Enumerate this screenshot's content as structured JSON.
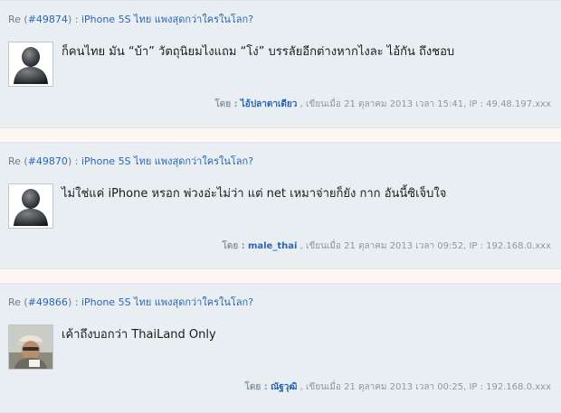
{
  "comments": [
    {
      "prefix": "Re (",
      "id_link": "#49874",
      "suffix": ") : ",
      "topic": "iPhone 5S ไทย แพงสุดกว่าใครในโลก?",
      "text": "ก็คนไทย มัน “บ้า” วัตถุนิยมไงแถม “โง่” บรรลัยอีกต่างหากไงละ ไอ้กัน ถึงชอบ",
      "by_label": "โดย :",
      "author": "ไอ้ปลาตาเดียว",
      "posted": ", เขียนเมื่อ 21 ตุลาคม 2013 เวลา 15:41, IP : 49.48.197.xxx",
      "avatar": "default-user-avatar"
    },
    {
      "prefix": "Re (",
      "id_link": "#49870",
      "suffix": ") : ",
      "topic": "iPhone 5S ไทย แพงสุดกว่าใครในโลก?",
      "text": "ไม่ใช่แค่ iPhone หรอก พ่วงอ่ะไม่ว่า แต่ net เหมาจ่ายก็ยัง กาก อันนี้ซิเจ็บใจ",
      "by_label": "โดย :",
      "author": "male_thai",
      "posted": ", เขียนเมื่อ 21 ตุลาคม 2013 เวลา 09:52, IP : 192.168.0.xxx",
      "avatar": "default-user-avatar"
    },
    {
      "prefix": "Re (",
      "id_link": "#49866",
      "suffix": ") : ",
      "topic": "iPhone 5S ไทย แพงสุดกว่าใครในโลก?",
      "text": "เค้าถึงบอกว่า ThaiLand Only",
      "by_label": "โดย :",
      "author": "ณัฐวุฒิ",
      "posted": ", เขียนเมื่อ 21 ตุลาคม 2013 เวลา 00:25, IP : 192.168.0.xxx",
      "avatar": "user-photo-avatar"
    }
  ]
}
